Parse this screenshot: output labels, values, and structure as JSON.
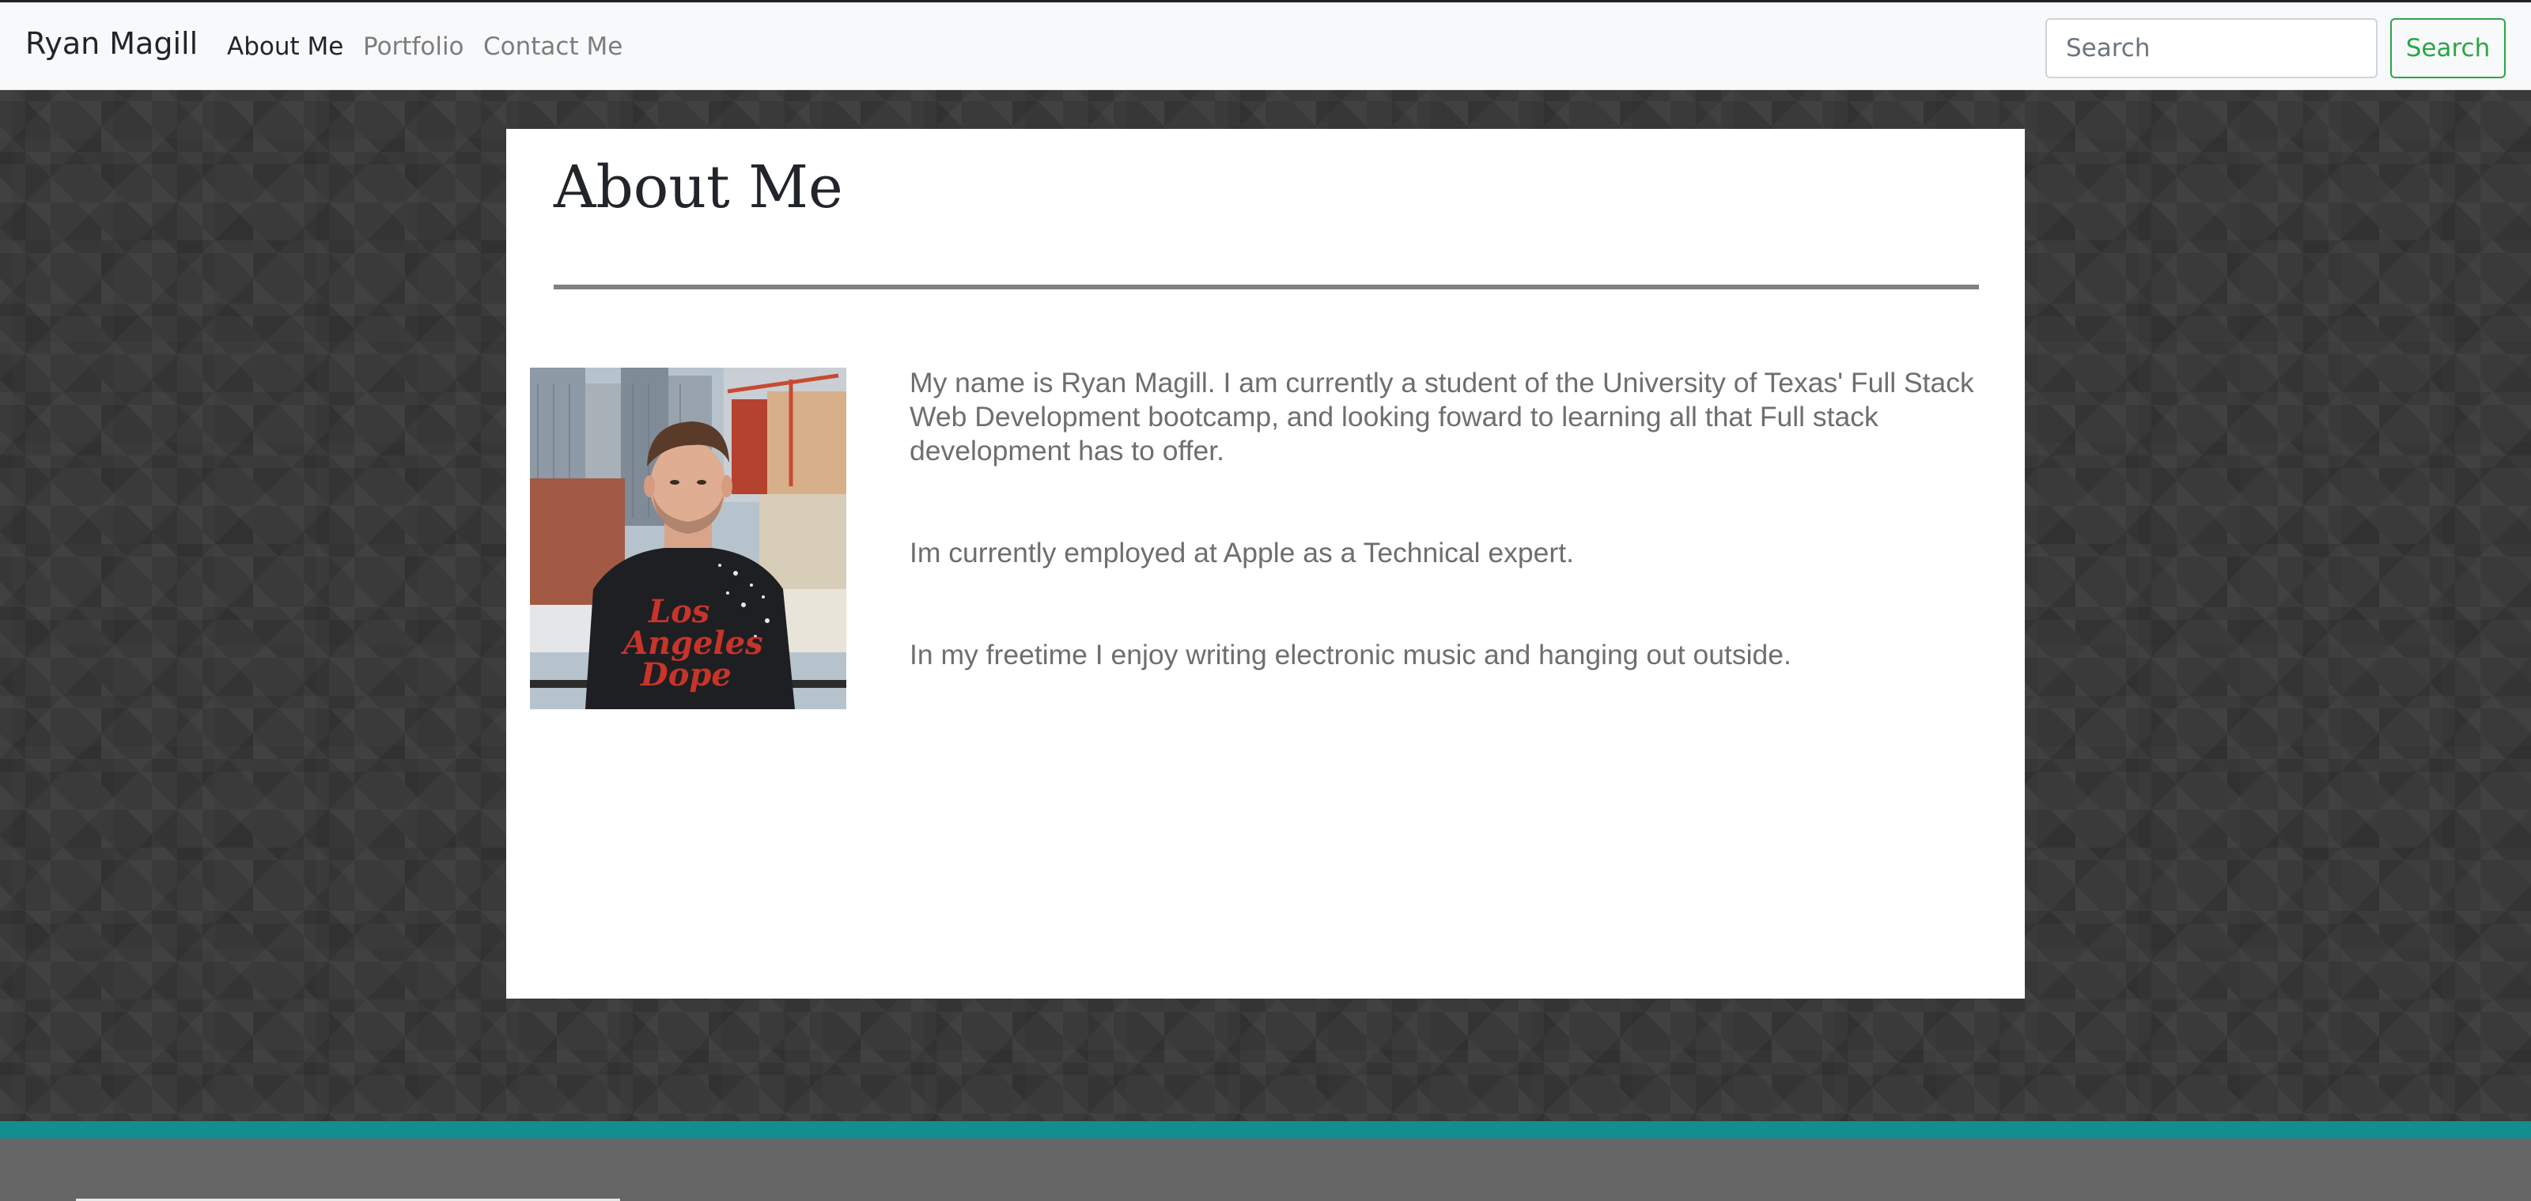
{
  "navbar": {
    "brand": "Ryan Magill",
    "links": [
      {
        "label": "About Me",
        "active": true
      },
      {
        "label": "Portfolio",
        "active": false
      },
      {
        "label": "Contact Me",
        "active": false
      }
    ],
    "search": {
      "placeholder": "Search",
      "value": "",
      "button_label": "Search"
    }
  },
  "main": {
    "title": "About Me",
    "bio": [
      "My name is Ryan Magill. I am currently a student of the University of Texas' Full Stack Web Development bootcamp, and looking foward to learning all that Full stack development has to offer.",
      "Im currently employed at Apple as a Technical expert.",
      "In my freetime I enjoy writing electronic music and hanging out outside."
    ],
    "photo": {
      "shirt_text": [
        "Los",
        "Angeles",
        "Dope"
      ]
    }
  },
  "colors": {
    "brand_green": "#28a745",
    "footer_accent": "#138d8d",
    "footer_bg": "#666666",
    "page_bg": "#3a3a3a"
  }
}
